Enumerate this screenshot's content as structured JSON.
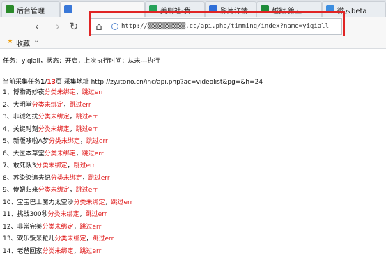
{
  "tabs": [
    {
      "label": "后台管理",
      "color": "#2a8a2a",
      "active": false
    },
    {
      "label": "",
      "color": "#3a78d8",
      "active": true
    },
    {
      "label": "美剧社-我",
      "color": "#25a25a",
      "active": false
    },
    {
      "label": "影片详情",
      "color": "#2f6fd8",
      "active": false
    },
    {
      "label": "越狱 第五",
      "color": "#1e8c3a",
      "active": false
    },
    {
      "label": "微云beta",
      "color": "#3c8ee0",
      "active": false
    }
  ],
  "nav": {
    "back": "‹",
    "forward": "›",
    "refresh": "↻",
    "home": "⌂"
  },
  "url": "http://▒▒▒▒▒▒▒▒▒▒.cc/api.php/timming/index?name=yiqiall",
  "bookmarks": {
    "label": "收藏",
    "chevron": "⌄"
  },
  "content": {
    "task": "任务：yiqiall，状态：开启，上次执行时间：从未---执行",
    "current_prefix": "当前采集任务",
    "current_page": "1",
    "page_sep": "/",
    "total_pages": "13",
    "current_suffix": "页 采集地址 http://zy.itono.cn/inc/api.php?ac=videolist&pg=&h=24",
    "unbound_label": "分类未绑定",
    "sep": "，",
    "skip_label": "跳过err",
    "items": [
      "1、博物奇妙夜",
      "2、大明堂",
      "3、非诚勿扰",
      "4、关键时刻",
      "5、新版哆啦A梦",
      "6、大医本草堂",
      "7、敢死队3",
      "8、苏染染追夫记",
      "9、傻妞归来",
      "10、宝宝巴士魔力太空沙",
      "11、挑战300秒",
      "12、非常完美",
      "13、欢乐饭米粒儿",
      "14、老爸回家"
    ]
  }
}
